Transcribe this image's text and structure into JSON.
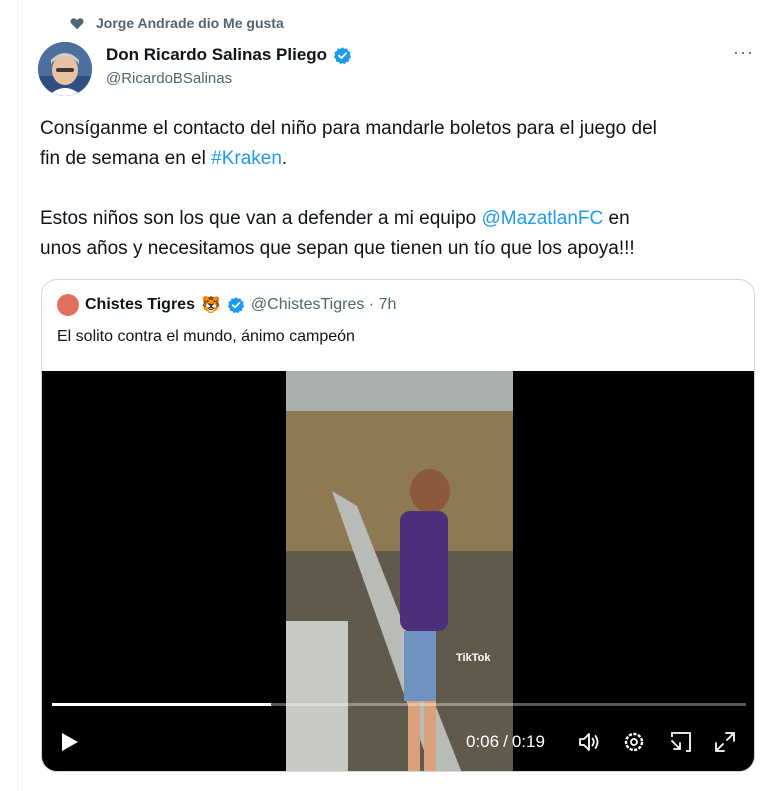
{
  "social_context": {
    "icon": "heart-icon",
    "text": "Jorge Andrade dio Me gusta"
  },
  "author": {
    "name": "Don Ricardo Salinas Pliego",
    "handle": "@RicardoBSalinas",
    "verified": true
  },
  "more_label": "···",
  "tweet": {
    "line1": "Consíganme el contacto del niño para mandarle boletos para el juego del",
    "line2_pre": "fin de semana en el ",
    "hashtag": "#Kraken",
    "line2_post": ".",
    "line3_pre": "Estos niños son los que van a defender a mi equipo ",
    "mention": "@MazatlanFC",
    "line3_post": " en",
    "line4": "unos años y necesitamos que sepan que tienen un tío que los apoya!!!"
  },
  "quote": {
    "name": "Chistes Tigres",
    "emoji": "🐯",
    "handle_time": "@ChistesTigres · 7h",
    "text": "El solito contra el mundo, ánimo campeón",
    "video": {
      "watermark": "TikTok",
      "current_time": "0:06",
      "separator": "/",
      "duration": "0:19",
      "progress": 0.316
    }
  },
  "colors": {
    "link": "#1d9bf0",
    "verified": "#1d9bf0",
    "muted": "#536471"
  }
}
